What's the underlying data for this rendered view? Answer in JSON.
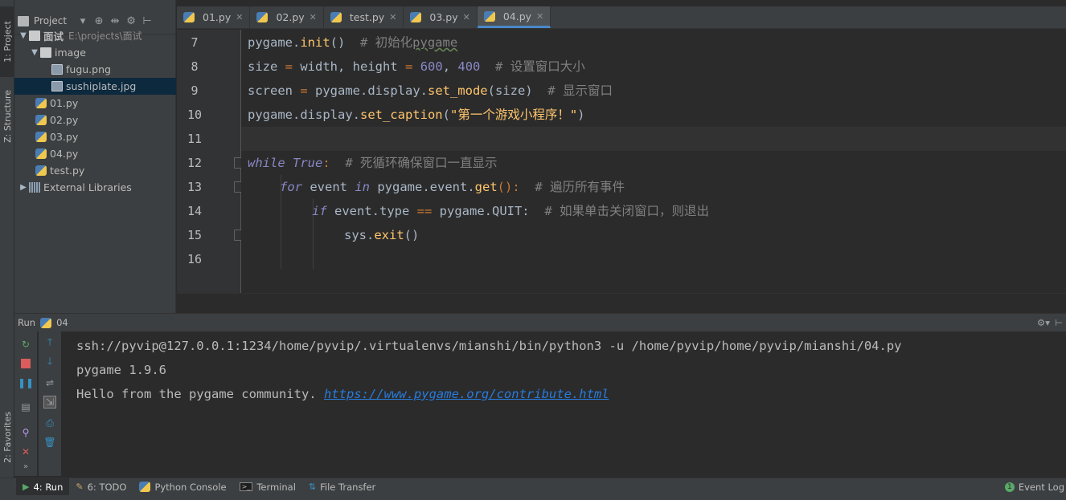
{
  "left_strip": {
    "project_tab": "1: Project",
    "structure_tab": "Z: Structure",
    "favorites_tab": "2: Favorites"
  },
  "project_panel": {
    "title": "Project",
    "tree": [
      {
        "label": "面试",
        "path": "E:\\projects\\面试",
        "type": "folder-open"
      },
      {
        "label": "image",
        "type": "folder-open"
      },
      {
        "label": "fugu.png",
        "type": "image"
      },
      {
        "label": "sushiplate.jpg",
        "type": "image",
        "selected": true
      },
      {
        "label": "01.py",
        "type": "python"
      },
      {
        "label": "02.py",
        "type": "python"
      },
      {
        "label": "03.py",
        "type": "python"
      },
      {
        "label": "04.py",
        "type": "python"
      },
      {
        "label": "test.py",
        "type": "python"
      },
      {
        "label": "External Libraries",
        "type": "library"
      }
    ]
  },
  "editor": {
    "tabs": [
      {
        "label": "01.py"
      },
      {
        "label": "02.py"
      },
      {
        "label": "test.py"
      },
      {
        "label": "03.py"
      },
      {
        "label": "04.py",
        "active": true
      }
    ],
    "line_numbers": [
      "7",
      "8",
      "9",
      "10",
      "11",
      "12",
      "13",
      "14",
      "15",
      "16"
    ],
    "code": {
      "l7": {
        "a": "pygame.",
        "b": "init",
        "c": "()  ",
        "d": "# 初始化",
        "e": "pygame"
      },
      "l8": {
        "a": "size ",
        "b": "=",
        "c": " width, height ",
        "d": "=",
        "e": " ",
        "f": "600",
        "g": ", ",
        "h": "400",
        "i": "  ",
        "j": "# 设置窗口大小"
      },
      "l9": {
        "a": "screen ",
        "b": "=",
        "c": " pygame.display.",
        "d": "set_mode",
        "e": "(size)  ",
        "f": "# 显示窗口"
      },
      "l10": {
        "a": "pygame.display.",
        "b": "set_caption",
        "c": "(",
        "d": "\"第一个游戏小程序！\"",
        "e": ")"
      },
      "l12": {
        "a": "while",
        "b": " ",
        "c": "True",
        "d": ":  ",
        "e": "# 死循环确保窗口一直显示"
      },
      "l13": {
        "a": "for",
        "b": " event ",
        "c": "in",
        "d": " pygame.event.",
        "e": "get",
        "f": "():  ",
        "g": "# 遍历所有事件"
      },
      "l14": {
        "a": "if",
        "b": " event.type ",
        "c": "==",
        "d": " pygame.QUIT:  ",
        "e": "# 如果单击关闭窗口，则退出"
      },
      "l15": {
        "a": "sys.",
        "b": "exit",
        "c": "()"
      }
    }
  },
  "run_panel": {
    "label": "Run",
    "config": "04",
    "console": [
      "ssh://pyvip@127.0.0.1:1234/home/pyvip/.virtualenvs/mianshi/bin/python3 -u /home/pyvip/home/pyvip/mianshi/04.py",
      "pygame 1.9.6",
      "Hello from the pygame community. "
    ],
    "link": "https://www.pygame.org/contribute.html"
  },
  "bottom_bar": {
    "run": "4: Run",
    "todo": "6: TODO",
    "python_console": "Python Console",
    "terminal": "Terminal",
    "file_transfer": "File Transfer",
    "event_log": "Event Log"
  },
  "colors": {
    "background": "#2b2b2b",
    "panel": "#3c3f41",
    "keyword": "#cc7832",
    "function": "#ffc66d",
    "number": "#6897bb",
    "string": "#6a8759",
    "comment": "#808080",
    "link": "#287bde",
    "selection": "#0d293e"
  }
}
